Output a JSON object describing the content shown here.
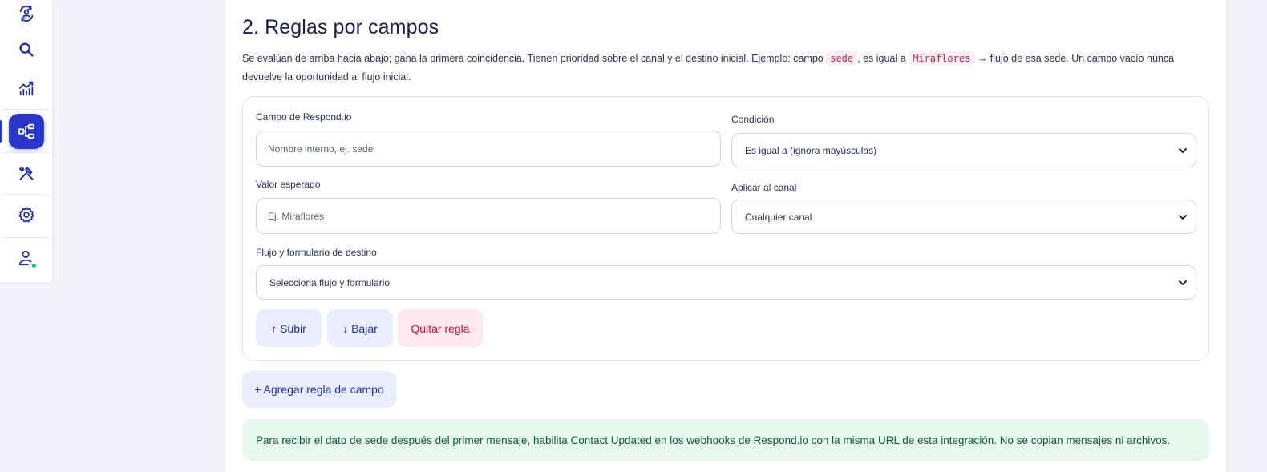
{
  "sidebar": {
    "items": [
      {
        "icon": "sync-person-icon",
        "active": false
      },
      {
        "icon": "search-icon",
        "active": false
      },
      {
        "icon": "analytics-icon",
        "active": false
      },
      {
        "icon": "flow-diagram-icon",
        "active": true
      },
      {
        "icon": "tools-icon",
        "active": false
      },
      {
        "icon": "gear-icon",
        "active": false
      },
      {
        "icon": "user-status-icon",
        "active": false
      }
    ],
    "accent_color": "#2a36c8",
    "status_color": "#16c060"
  },
  "section": {
    "title": "2. Reglas por campos",
    "desc_part1": "Se evalúan de arriba hacia abajo; gana la primera coincidencia. Tienen prioridad sobre el canal y el destino inicial. Ejemplo: campo ",
    "code_field": "sede",
    "desc_part2": ", es igual a ",
    "code_value": "Miraflores",
    "desc_part3": " → flujo de esa sede. Un campo vacío nunca devuelve la oportunidad al flujo inicial."
  },
  "rule": {
    "field_label": "Campo de Respond.io",
    "field_placeholder": "Nombre interno, ej. sede",
    "condition_label": "Condición",
    "condition_value": "Es igual a (ignora mayúsculas)",
    "expected_label": "Valor esperado",
    "expected_placeholder": "Ej. Miraflores",
    "channel_label": "Aplicar al canal",
    "channel_value": "Cualquier canal",
    "flow_label": "Flujo y formulario de destino",
    "flow_value": "Selecciona flujo y formulario",
    "up_label": "↑ Subir",
    "down_label": "↓ Bajar",
    "remove_label": "Quitar regla"
  },
  "add_rule_label": "+ Agregar regla de campo",
  "notice": {
    "text": "Para recibir el dato de sede después del primer mensaje, habilita Contact Updated en los webhooks de Respond.io con la misma URL de esta integración. No se copian mensajes ni archivos.",
    "color": "#e8f8ef"
  }
}
